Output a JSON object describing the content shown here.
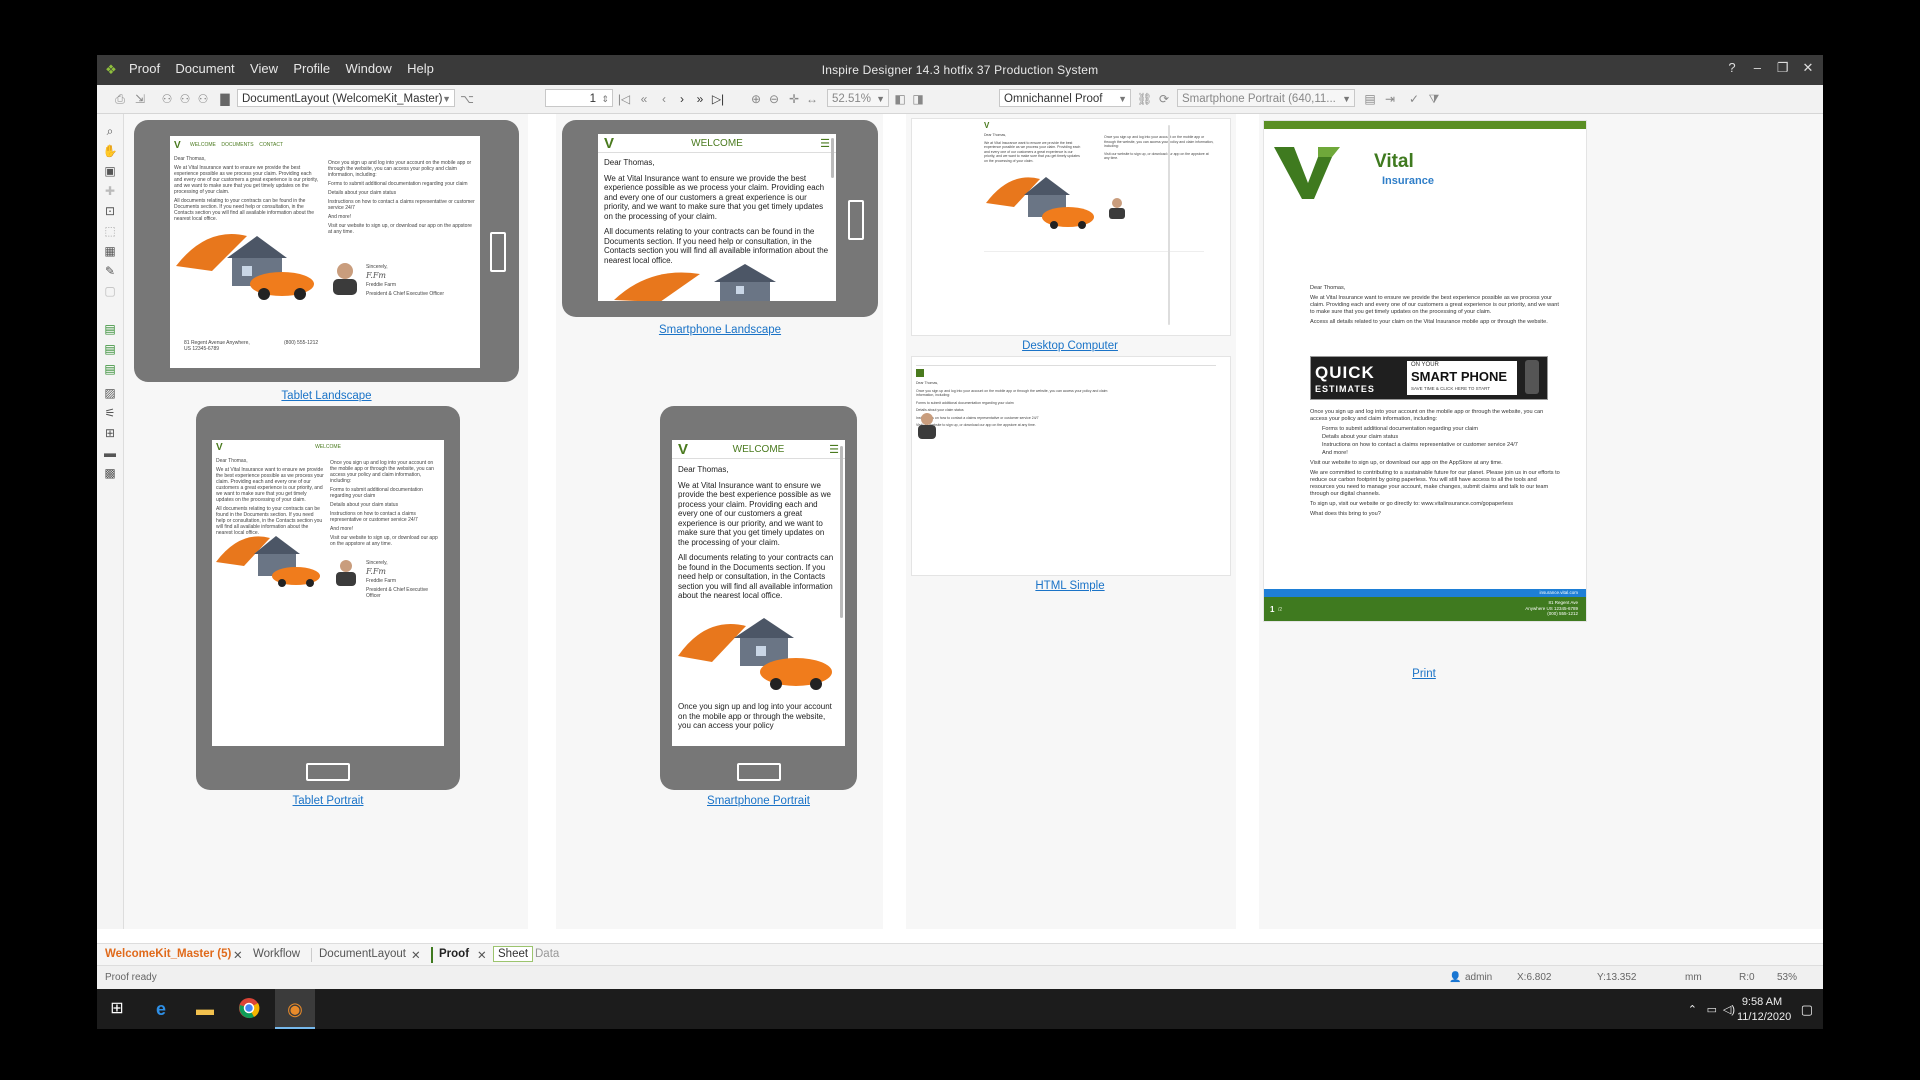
{
  "window": {
    "title": "Inspire Designer 14.3 hotfix 37 Production System",
    "menu": [
      "Proof",
      "Document",
      "View",
      "Profile",
      "Window",
      "Help"
    ],
    "controls": [
      "?",
      "–",
      "❐",
      "✕"
    ]
  },
  "toolbar": {
    "layout_combo": "DocumentLayout (WelcomeKit_Master)",
    "page_number": "1",
    "zoom": "52.51%",
    "proof_mode": "Omnichannel Proof",
    "device_profile": "Smartphone Portrait (640,11..."
  },
  "previews": {
    "tablet_landscape": {
      "label": "Tablet Landscape"
    },
    "tablet_portrait": {
      "label": "Tablet Portrait"
    },
    "smartphone_landscape": {
      "label": "Smartphone Landscape"
    },
    "smartphone_portrait": {
      "label": "Smartphone Portrait"
    },
    "desktop": {
      "label": "Desktop Computer"
    },
    "html_simple": {
      "label": "HTML Simple"
    },
    "print": {
      "label": "Print"
    }
  },
  "mobile": {
    "header": "WELCOME",
    "greeting": "Dear Thomas,",
    "para1_landscape": "We at Vital Insurance want to ensure we provide the best experience possible as we process your claim. Providing each and every one of our customers a great experience is our priority, and we want to make sure that you get timely updates on the processing of your claim.",
    "para2_landscape": "All documents relating to your contracts can be found in the Documents section. If you need help or consultation, in the Contacts section you will find all available information about the nearest local office.",
    "para1_portrait": "We at Vital Insurance want to ensure we provide the best experience possible as we process your claim. Providing each and every one of our customers a great experience is our priority, and we want to make sure that you get timely updates on the processing of your claim.",
    "para2_portrait": "All documents relating to your contracts can be found in the Documents section. If you need help or consultation, in the Contacts section you will find all available information about the nearest local office.",
    "para3_portrait": "Once you sign up and log into your account on the mobile app or through the website, you can access your policy"
  },
  "tablet": {
    "nav": [
      "WELCOME",
      "DOCUMENTS",
      "CONTACT"
    ],
    "portrait_header": "WELCOME",
    "greeting": "Dear Thomas,",
    "text_left": "We at Vital Insurance want to ensure we provide the best experience possible as we process your claim. Providing each and every one of our customers a great experience is our priority, and we want to make sure that you get timely updates on the processing of your claim.",
    "text_left2": "All documents relating to your contracts can be found in the Documents section. If you need help or consultation, in the Contacts section you will find all available information about the nearest local office.",
    "text_right": "Once you sign up and log into your account on the mobile app or through the website, you can access your policy and claim information, including:",
    "bullets": [
      "Forms to submit additional documentation regarding your claim",
      "Details about your claim status",
      "Instructions on how to contact a claims representative or customer service 24/7",
      "And more!"
    ],
    "visit": "Visit our website to sign up, or download our app on the appstore at any time.",
    "sincerely": "Sincerely,",
    "signer": "Freddie Farm",
    "signer_title": "President & Chief Executive Officer",
    "address": "81 Regent Avenue Anywhere, US 12345-6789",
    "phone": "(800) 555-1212"
  },
  "print_doc": {
    "brand": "Vital",
    "brand_sub": "Insurance",
    "greeting": "Dear Thomas,",
    "para1": "We at Vital Insurance want to ensure we provide the best experience possible as we process your claim. Providing each and every one of our customers a great experience is our priority, and we want to make sure that you get timely updates on the processing of your claim.",
    "para2": "Access all details related to your claim on the Vital Insurance mobile app or through the website.",
    "banner_quick": "QUICK",
    "banner_estimates": "ESTIMATES",
    "banner_on_your": "ON YOUR",
    "banner_smart": "SMART PHONE",
    "banner_save": "SAVE TIME & CLICK HERE TO START",
    "para3": "Once you sign up and log into your account on the mobile app or through the website, you can access your policy and claim information, including:",
    "bullets": [
      "Forms to submit additional documentation regarding your claim",
      "Details about your claim status",
      "Instructions on how to contact a claims representative or customer service 24/7",
      "And more!"
    ],
    "para4": "Visit our website to sign up, or download our app on the AppStore at any time.",
    "para5": "We are committed to contributing to a sustainable future for our planet. Please join us in our efforts to reduce our carbon footprint by going paperless. You will still have access to all the tools and resources you need to manage your account, make changes, submit claims and talk to our team through our digital channels.",
    "para6": "To sign up, visit our website or go directly to: www.vitalinsurance.com/gopaperless",
    "para7": "What does this bring to you?",
    "footer_page": "1",
    "footer_pages": "/2",
    "footer_site": "insurance.vital.com",
    "footer_addr1": "81 Regent Ave",
    "footer_addr2": "Anywhere US 12345-6789",
    "footer_phone": "(000) 555-1212"
  },
  "tabs": {
    "doc": "WelcomeKit_Master (5)",
    "workflow": "Workflow",
    "layout": "DocumentLayout",
    "proof": "Proof",
    "sheet": "Sheet",
    "data": "Data"
  },
  "status": {
    "message": "Proof ready",
    "user": "admin",
    "x": "X:6.802",
    "y": "Y:13.352",
    "unit": "mm",
    "r": "R:0",
    "zoom": "53%"
  },
  "taskbar": {
    "time": "9:58 AM",
    "date": "11/12/2020"
  },
  "colors": {
    "brand_green": "#4a7a1e",
    "link_blue": "#1a73c7",
    "tab_orange": "#e06a1b",
    "footer_blue": "#1e7fd6"
  }
}
